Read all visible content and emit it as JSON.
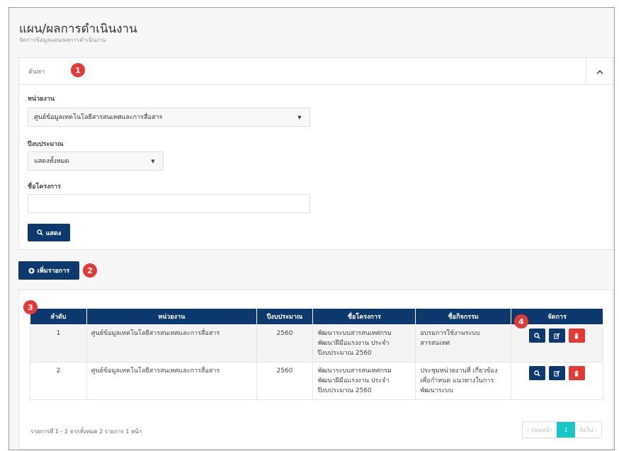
{
  "header": {
    "title": "แผน/ผลการดำเนินงาน",
    "breadcrumb": "จัดการข้อมูลแผน/ผลการดำเนินงาน"
  },
  "search": {
    "label": "ค้นหา",
    "unit_label": "หน่วยงาน",
    "unit_value": "ศูนย์ข้อมูลเทคโนโลยีสารสนเทศและการสื่อสาร",
    "year_label": "ปีงบประมาณ",
    "year_value": "แสดงทั้งหมด",
    "project_label": "ชื่อโครงการ",
    "project_value": "",
    "show_button": "แสดง"
  },
  "add_button": "เพิ่มรายการ",
  "markers": [
    "1",
    "2",
    "3",
    "4"
  ],
  "table": {
    "headers": [
      "ลำดับ",
      "หน่วยงาน",
      "ปีงบประมาณ",
      "ชื่อโครงการ",
      "ชื่อกิจกรรม",
      "จัดการ"
    ],
    "rows": [
      {
        "no": "1",
        "unit": "ศูนย์ข้อมูลเทคโนโลยีสารสนเทศและการสื่อสาร",
        "year": "2560",
        "project": "พัฒนาระบบสารสนเทศกรม พัฒนาฝีมือแรงงาน ประจำ ปีงบประมาณ 2560",
        "activity": "อบรมการใช้งานระบบ สารสนเทศ"
      },
      {
        "no": "2",
        "unit": "ศูนย์ข้อมูลเทคโนโลยีสารสนเทศและการสื่อสาร",
        "year": "2560",
        "project": "พัฒนาระบบสารสนเทศกรม พัฒนาฝีมือแรงงาน ประจำ ปีงบประมาณ 2560",
        "activity": "ประชุมหน่วยงานที่ เกี่ยวข้องเพื่อกำหนด แนวทางในการพัฒนาระบบ"
      }
    ]
  },
  "footer": {
    "summary": "รายการที่ 1 - 2 จากทั้งหมด 2 รายการ 1 หน้า",
    "prev": "‹ ก่อนหน้า",
    "page": "1",
    "next": "ถัดไป ›"
  }
}
